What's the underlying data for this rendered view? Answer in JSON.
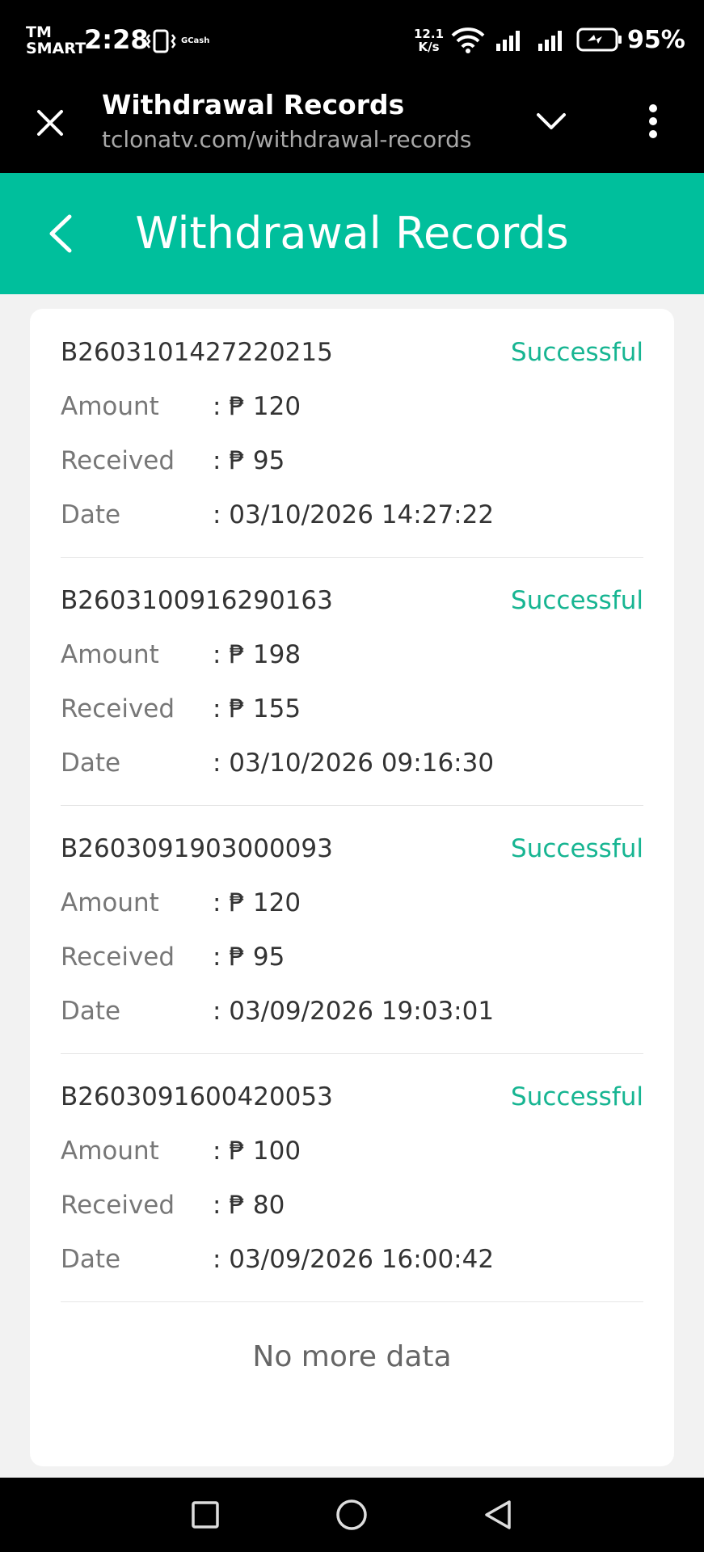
{
  "status_bar": {
    "carrier_line1": "TM",
    "carrier_line2": "SMART",
    "time": "2:28",
    "gcash_label": "GCash",
    "speed_value": "12.1",
    "speed_unit": "K/s",
    "battery": "95%"
  },
  "browser": {
    "title": "Withdrawal Records",
    "url": "tclonatv.com/withdrawal-records"
  },
  "header": {
    "title": "Withdrawal Records"
  },
  "labels": {
    "amount": "Amount",
    "received": "Received",
    "date": "Date"
  },
  "records": [
    {
      "id": "B2603101427220215",
      "status": "Successful",
      "amount": ": ₱ 120",
      "received": ": ₱ 95",
      "date": ": 03/10/2026 14:27:22"
    },
    {
      "id": "B2603100916290163",
      "status": "Successful",
      "amount": ": ₱ 198",
      "received": ": ₱ 155",
      "date": ": 03/10/2026 09:16:30"
    },
    {
      "id": "B2603091903000093",
      "status": "Successful",
      "amount": ": ₱ 120",
      "received": ": ₱ 95",
      "date": ": 03/09/2026 19:03:01"
    },
    {
      "id": "B2603091600420053",
      "status": "Successful",
      "amount": ": ₱ 100",
      "received": ": ₱ 80",
      "date": ": 03/09/2026 16:00:42"
    }
  ],
  "footer": {
    "no_more": "No more data"
  },
  "colors": {
    "accent": "#00bf9c",
    "status_success": "#17b592"
  },
  "icons": {
    "status": [
      "vibrate-icon",
      "wifi-icon",
      "signal-icon",
      "signal-icon",
      "battery-charging-icon"
    ],
    "browser": [
      "close-icon",
      "chevron-down-icon",
      "more-vertical-icon"
    ],
    "header": [
      "back-chevron-icon"
    ],
    "nav": [
      "square-icon",
      "circle-icon",
      "triangle-back-icon"
    ]
  }
}
